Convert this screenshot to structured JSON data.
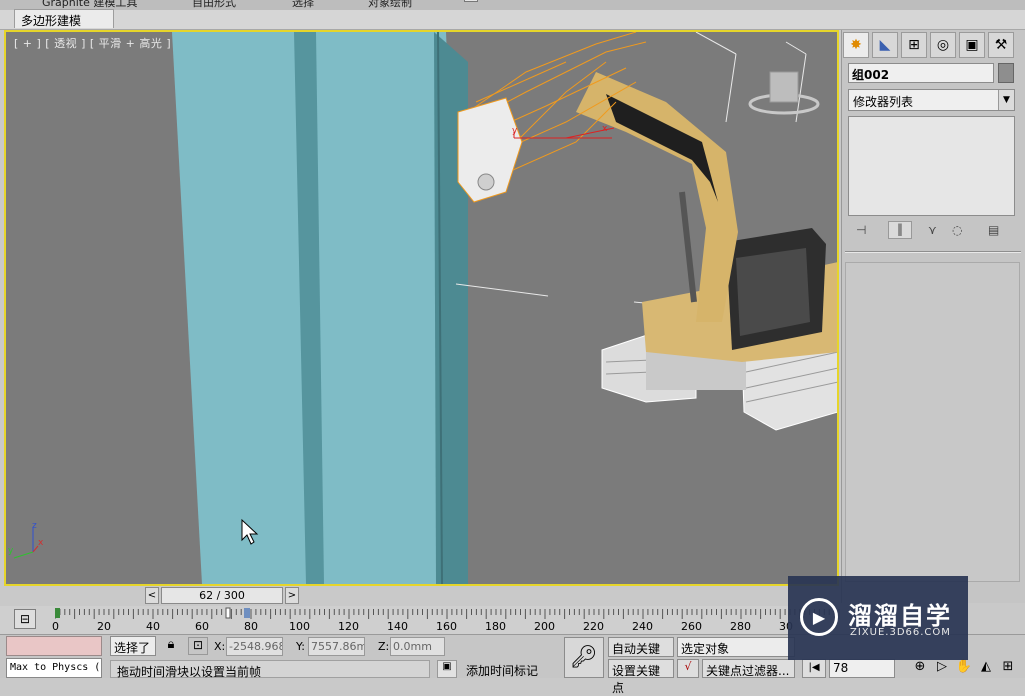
{
  "ribbon": {
    "top_tabs": [
      "Graphite 建模工具",
      "自由形式",
      "选择",
      "对象绘制"
    ],
    "subtab": "多边形建模"
  },
  "viewport": {
    "label": "[ + ] [ 透视 ] [ 平滑 + 高光 ]",
    "axis": {
      "z": "z",
      "y": "y",
      "x": "x"
    },
    "gizmo": {
      "y": "y",
      "x": "x"
    },
    "border_color": "#e6d52a",
    "bg_color": "#7a7a7a",
    "column_color": "#7fbcc6"
  },
  "command_panel": {
    "tab_icons": [
      "create-icon",
      "modify-icon",
      "hierarchy-icon",
      "motion-icon",
      "display-icon",
      "utilities-icon"
    ],
    "object_name": "组002",
    "modifier_list": "修改器列表"
  },
  "time_slider": {
    "prev": "<",
    "next": ">",
    "label": "62 / 300"
  },
  "track_bar": {
    "ticks": [
      "0",
      "20",
      "40",
      "60",
      "80",
      "100",
      "120",
      "140",
      "160",
      "180",
      "200",
      "220",
      "240",
      "260",
      "280",
      "30"
    ]
  },
  "status": {
    "script_text": "Max to Physcs (",
    "selection": "选择了",
    "x_label": "X:",
    "x_value": "-2548.968r",
    "y_label": "Y:",
    "y_value": "7557.86mr",
    "z_label": "Z:",
    "z_value": "0.0mm",
    "prompt": "拖动时间滑块以设置当前帧",
    "add_time_tag": "添加时间标记",
    "auto_key": "自动关键点",
    "set_key": "设置关键点",
    "selected_object": "选定对象",
    "key_filters": "关键点过滤器...",
    "frame": "78"
  },
  "watermark": {
    "cn": "溜溜自学",
    "en": "ZIXUE.3D66.COM"
  }
}
